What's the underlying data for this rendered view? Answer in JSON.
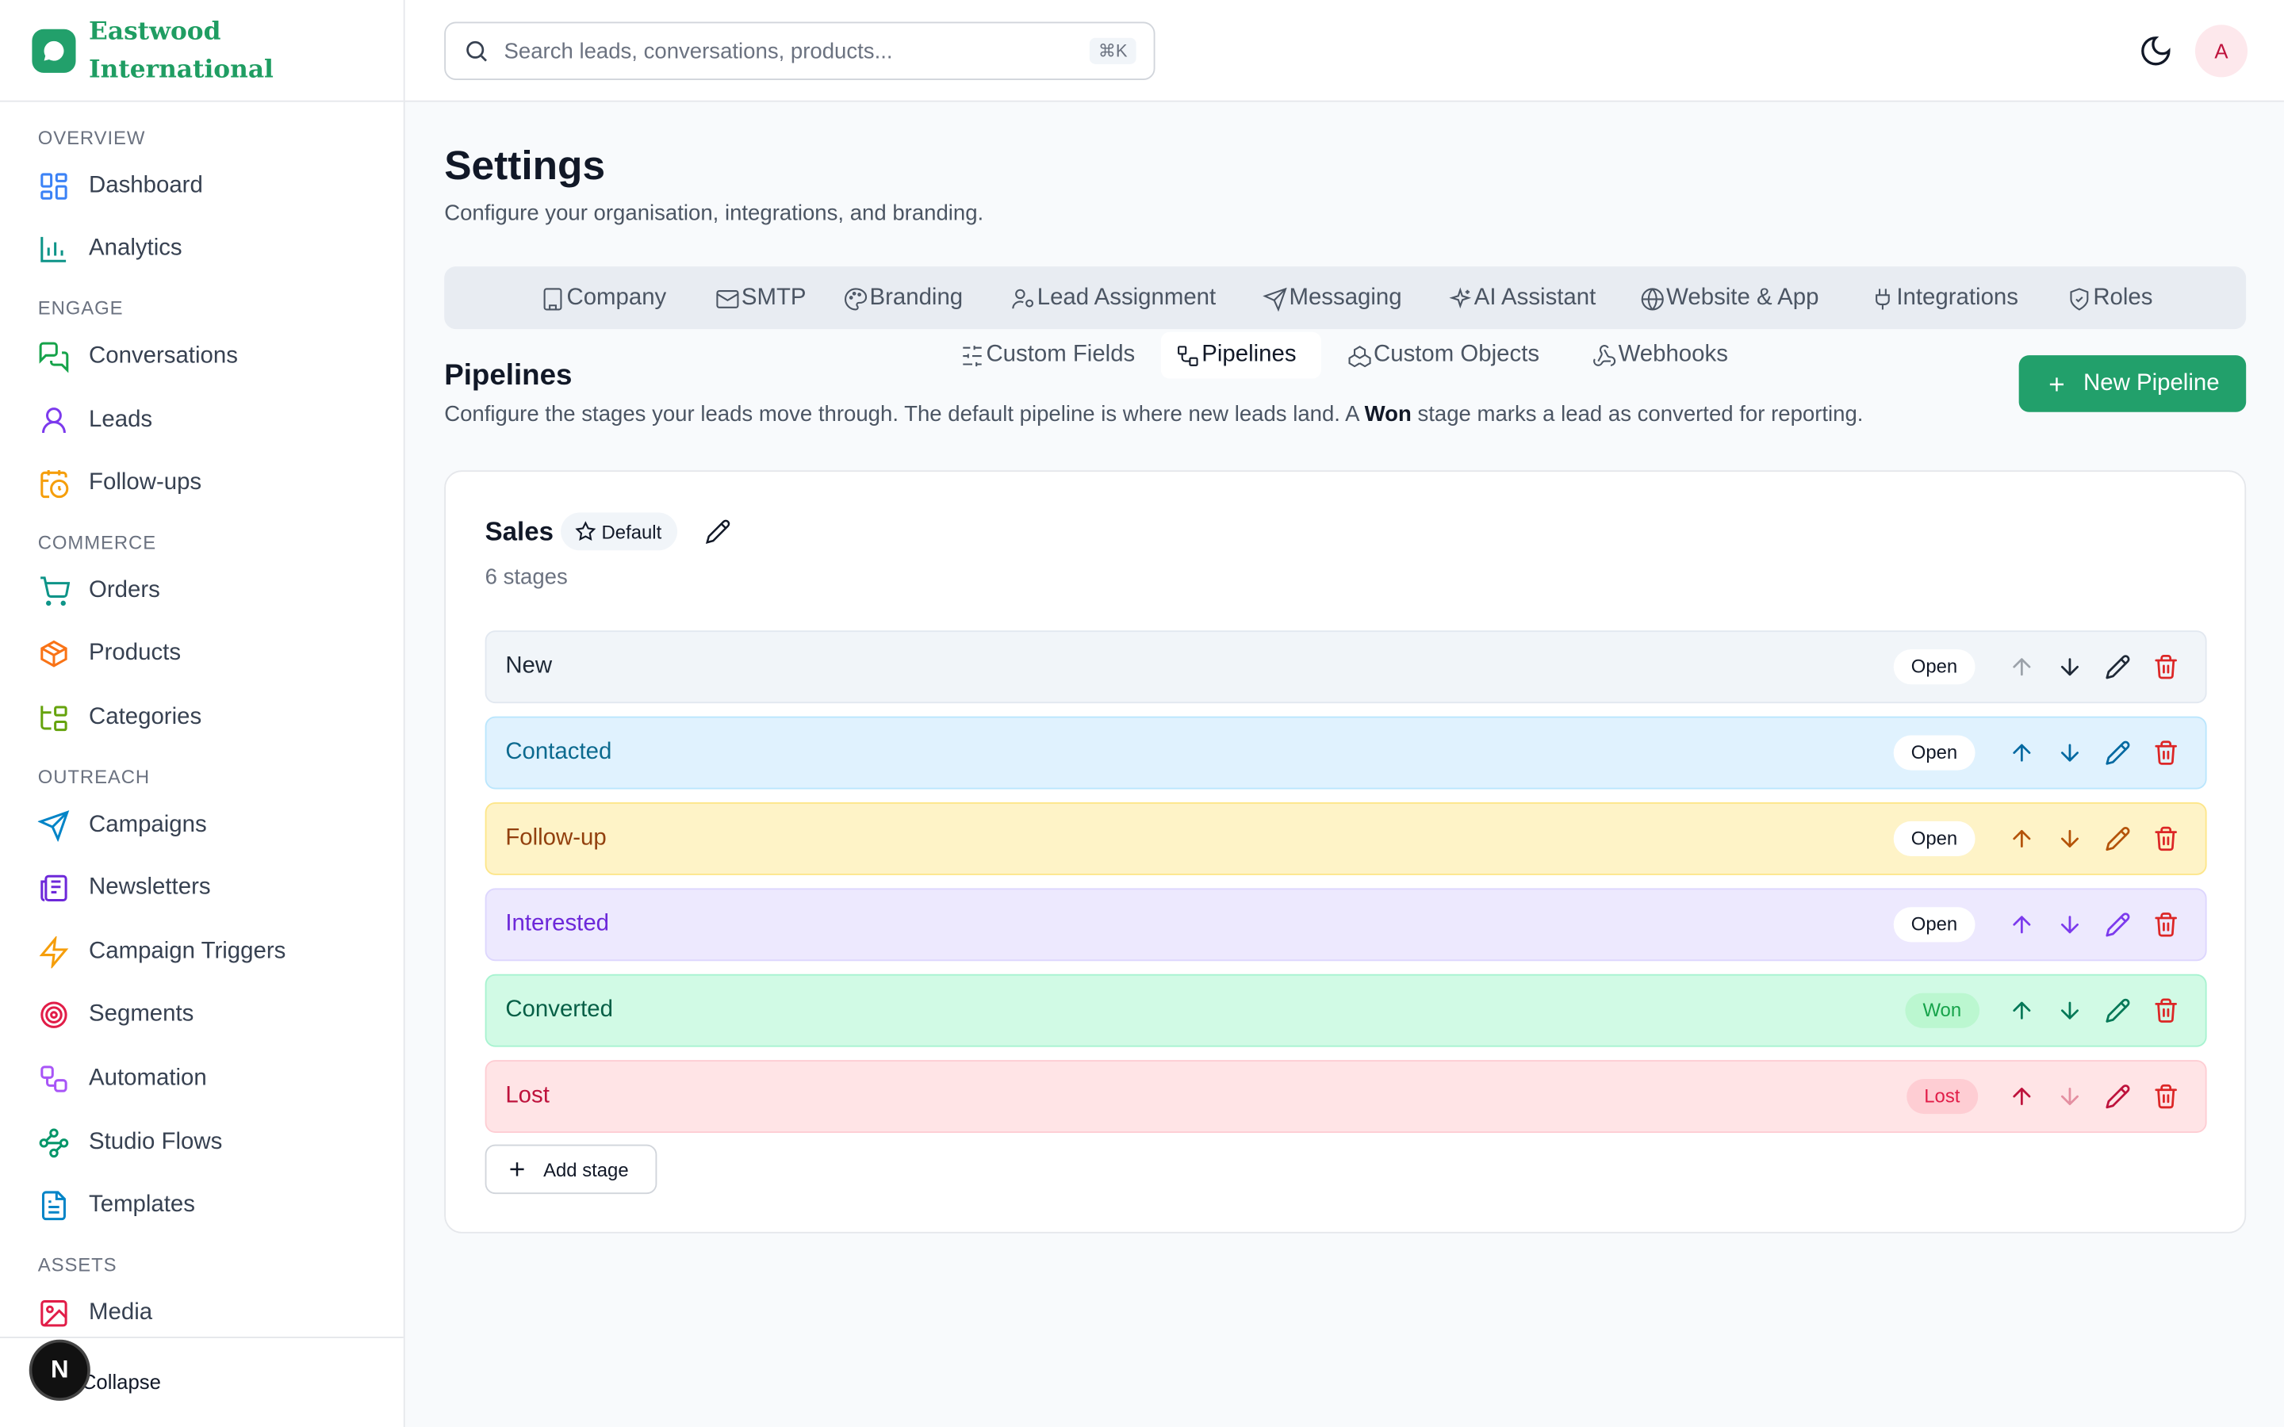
{
  "brand": {
    "name_line1": "Eastwood",
    "name_line2": "International"
  },
  "nav": {
    "sections": {
      "overview": "OVERVIEW",
      "engage": "ENGAGE",
      "commerce": "COMMERCE",
      "outreach": "OUTREACH",
      "assets": "ASSETS"
    },
    "items": {
      "dashboard": "Dashboard",
      "analytics": "Analytics",
      "conversations": "Conversations",
      "leads": "Leads",
      "followups": "Follow-ups",
      "orders": "Orders",
      "products": "Products",
      "categories": "Categories",
      "campaigns": "Campaigns",
      "newsletters": "Newsletters",
      "triggers": "Campaign Triggers",
      "segments": "Segments",
      "automation": "Automation",
      "studio": "Studio Flows",
      "templates": "Templates",
      "media": "Media"
    },
    "collapse": "Collapse",
    "n_badge": "N"
  },
  "topbar": {
    "search_placeholder": "Search leads, conversations, products...",
    "shortcut": "⌘K",
    "avatar": "A"
  },
  "page": {
    "title": "Settings",
    "subtitle": "Configure your organisation, integrations, and branding."
  },
  "tabs": {
    "company": "Company",
    "smtp": "SMTP",
    "branding": "Branding",
    "lead_assignment": "Lead Assignment",
    "messaging": "Messaging",
    "ai": "AI Assistant",
    "website": "Website & App",
    "integrations": "Integrations",
    "roles": "Roles",
    "custom_fields": "Custom Fields",
    "pipelines": "Pipelines",
    "custom_objects": "Custom Objects",
    "webhooks": "Webhooks"
  },
  "section": {
    "title": "Pipelines",
    "desc_before": "Configure the stages your leads move through. The default pipeline is where new leads land. A ",
    "desc_bold": "Won",
    "desc_after": " stage marks a lead as converted for reporting.",
    "new_button": "New Pipeline"
  },
  "pipeline": {
    "name": "Sales",
    "default_badge": "Default",
    "stage_count": "6 stages",
    "add_stage": "Add stage",
    "stages": [
      {
        "name": "New",
        "status": "Open",
        "bg": "#f1f5f9",
        "border": "#e2e8f0",
        "text": "#1f2937",
        "accent": "#1f2937"
      },
      {
        "name": "Contacted",
        "status": "Open",
        "bg": "#e0f2fe",
        "border": "#bae6fd",
        "text": "#0c6a8f",
        "accent": "#0369a1"
      },
      {
        "name": "Follow-up",
        "status": "Open",
        "bg": "#fef3c7",
        "border": "#fde68a",
        "text": "#92400e",
        "accent": "#b45309"
      },
      {
        "name": "Interested",
        "status": "Open",
        "bg": "#ede9fe",
        "border": "#ddd6fe",
        "text": "#6d28d9",
        "accent": "#7c3aed"
      },
      {
        "name": "Converted",
        "status": "Won",
        "bg": "#d1fae5",
        "border": "#a7f3d0",
        "text": "#065f46",
        "accent": "#047857"
      },
      {
        "name": "Lost",
        "status": "Lost",
        "bg": "#ffe4e6",
        "border": "#fecdd3",
        "text": "#be123c",
        "accent": "#be123c"
      }
    ]
  },
  "colors": {
    "brand": "#22a06b",
    "danger": "#dc2626"
  }
}
